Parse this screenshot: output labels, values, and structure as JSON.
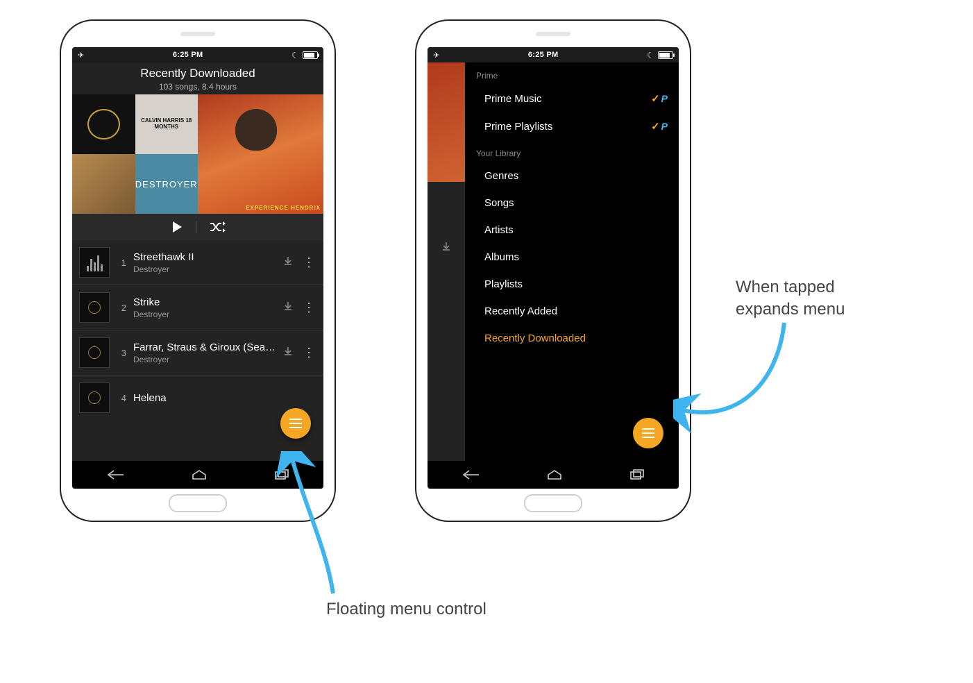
{
  "statusbar": {
    "time": "6:25 PM"
  },
  "screenA": {
    "header": {
      "title": "Recently Downloaded",
      "subtitle": "103 songs, 8.4 hours"
    },
    "collage": {
      "tile2_text": "CALVIN HARRIS 18 MONTHS",
      "tile4_text": "DESTROYER",
      "big_tag": "EXPERIENCE HENDRIX"
    },
    "songs": [
      {
        "idx": "1",
        "title": "Streethawk II",
        "artist": "Destroyer",
        "playing": true
      },
      {
        "idx": "2",
        "title": "Strike",
        "artist": "Destroyer",
        "playing": false
      },
      {
        "idx": "3",
        "title": "Farrar, Straus & Giroux (Sea of Te…",
        "artist": "Destroyer",
        "playing": false
      },
      {
        "idx": "4",
        "title": "Helena",
        "artist": "",
        "playing": false
      }
    ]
  },
  "screenB": {
    "sections": {
      "prime_label": "Prime",
      "library_label": "Your Library",
      "prime_items": [
        "Prime Music",
        "Prime Playlists"
      ],
      "library_items": [
        "Genres",
        "Songs",
        "Artists",
        "Albums",
        "Playlists",
        "Recently Added",
        "Recently Downloaded"
      ],
      "active_item": "Recently Downloaded"
    }
  },
  "annotations": {
    "left": "Floating menu control",
    "right_line1": "When tapped",
    "right_line2": "expands menu"
  }
}
